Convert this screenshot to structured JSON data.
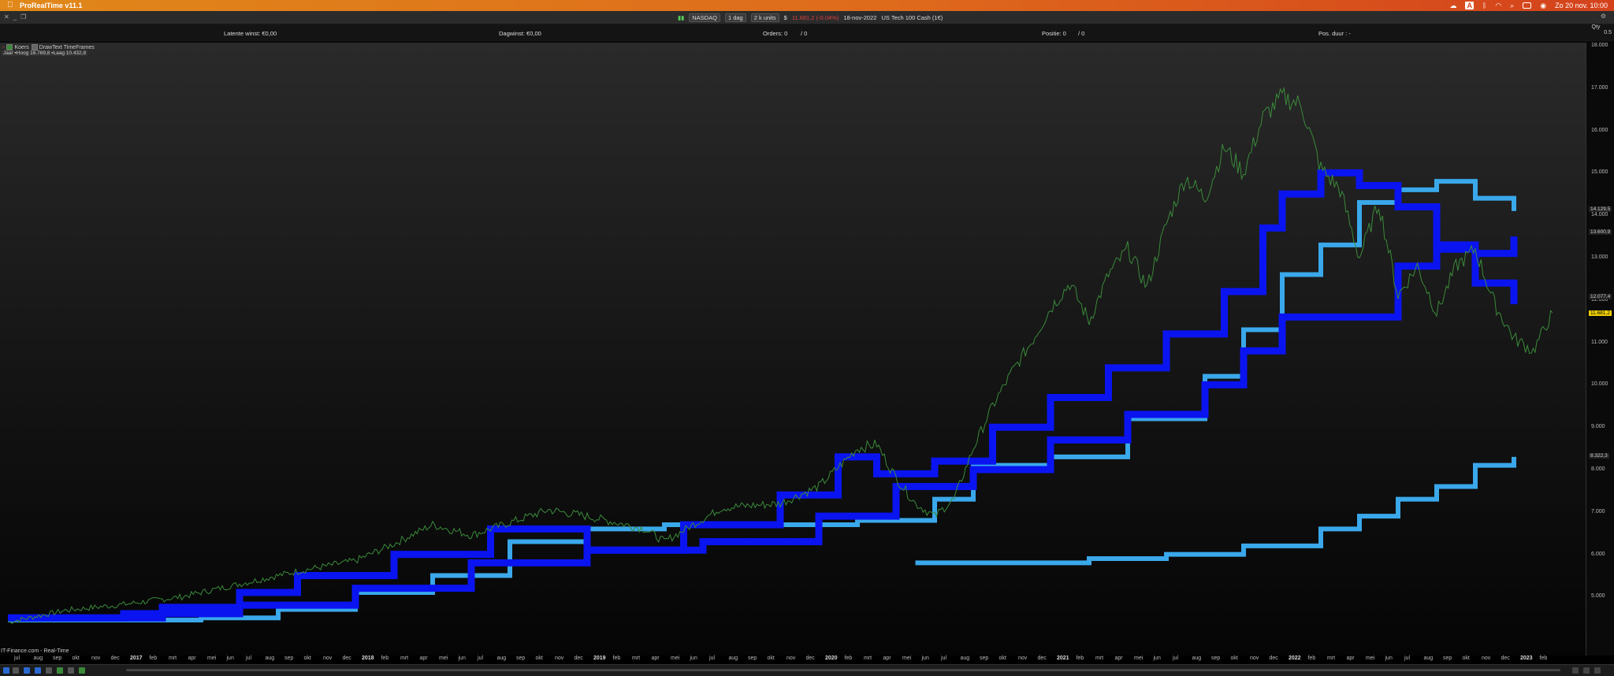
{
  "menubar": {
    "app_title": "ProRealTime v11.1",
    "datetime": "Zo 20 nov.  10:00",
    "status_letter": "A"
  },
  "toolbar": {
    "instrument": "NASDAQ",
    "timeframe": "1 dag",
    "units": "2 k units",
    "price_change": "11.681,2 (-0,04%)",
    "date": "18-nov-2022",
    "description": "US Tech 100 Cash (1€)"
  },
  "infobar": {
    "latent_gain": "Latente winst: €0,00",
    "day_gain": "Dagwinst: €0,00",
    "orders": "Orders: 0",
    "orders_suffix": "/ 0",
    "position": "Positie: 0",
    "position_suffix": "/ 0",
    "pos_duration": "Pos. duur : -",
    "qty_label": "Qty",
    "qty_value": "0.5"
  },
  "legend": {
    "item1": "Koers",
    "item2": "DrawText TimeFrames",
    "range": "Jaar ▪Hoog 16.769,8 ▪Laag 10.432,8"
  },
  "source": "IT-Finance.com - Real-Time",
  "colors": {
    "price_line": "#3a8a3a",
    "dark_blue": "#0a14f0",
    "light_blue": "#3aa8ea",
    "accent_yellow": "#f0d000"
  },
  "chart_data": {
    "type": "line",
    "y_ticks": [
      "18.000",
      "17.000",
      "16.000",
      "15.000",
      "14.000",
      "13.000",
      "12.000",
      "11.000",
      "10.000",
      "9.000",
      "8.000",
      "7.000",
      "6.000",
      "5.000"
    ],
    "price_labels": [
      "14.129,5",
      "13.600,9",
      "12.077,4",
      "11.681,2",
      "8.322,3"
    ],
    "highlighted_price": "11.681,2",
    "x_ticks": [
      "jul",
      "aug",
      "sep",
      "okt",
      "nov",
      "dec",
      "2017",
      "feb",
      "mrt",
      "apr",
      "mei",
      "jun",
      "jul",
      "aug",
      "sep",
      "okt",
      "nov",
      "dec",
      "2018",
      "feb",
      "mrt",
      "apr",
      "mei",
      "jun",
      "jul",
      "aug",
      "sep",
      "okt",
      "nov",
      "dec",
      "2019",
      "feb",
      "mrt",
      "apr",
      "mei",
      "jun",
      "jul",
      "aug",
      "sep",
      "okt",
      "nov",
      "dec",
      "2020",
      "feb",
      "mrt",
      "apr",
      "mei",
      "jun",
      "jul",
      "aug",
      "sep",
      "okt",
      "nov",
      "dec",
      "2021",
      "feb",
      "mrt",
      "apr",
      "mei",
      "jun",
      "jul",
      "aug",
      "sep",
      "okt",
      "nov",
      "dec",
      "2022",
      "feb",
      "mrt",
      "apr",
      "mei",
      "jun",
      "jul",
      "aug",
      "sep",
      "okt",
      "nov",
      "dec",
      "2023",
      "feb"
    ],
    "ylim": [
      4700,
      18000
    ],
    "price_series": [
      [
        0,
        4400
      ],
      [
        3,
        4680
      ],
      [
        6,
        4820
      ],
      [
        9,
        5000
      ],
      [
        12,
        5300
      ],
      [
        15,
        5600
      ],
      [
        18,
        5850
      ],
      [
        20,
        6250
      ],
      [
        22,
        6700
      ],
      [
        24,
        6450
      ],
      [
        26,
        6750
      ],
      [
        28,
        7050
      ],
      [
        30,
        6900
      ],
      [
        33,
        6600
      ],
      [
        34,
        6300
      ],
      [
        37,
        7100
      ],
      [
        40,
        7200
      ],
      [
        42,
        7600
      ],
      [
        44,
        8500
      ],
      [
        45,
        8600
      ],
      [
        46,
        7800
      ],
      [
        47,
        7200
      ],
      [
        48,
        6900
      ],
      [
        49,
        7300
      ],
      [
        50,
        8500
      ],
      [
        51,
        9500
      ],
      [
        52,
        10300
      ],
      [
        53,
        11000
      ],
      [
        54,
        11800
      ],
      [
        55,
        12400
      ],
      [
        56,
        11500
      ],
      [
        57,
        12600
      ],
      [
        58,
        13200
      ],
      [
        59,
        12300
      ],
      [
        60,
        13800
      ],
      [
        61,
        14900
      ],
      [
        62,
        14400
      ],
      [
        63,
        15600
      ],
      [
        64,
        15000
      ],
      [
        65,
        16300
      ],
      [
        66,
        16800
      ],
      [
        67,
        16600
      ],
      [
        68,
        15100
      ],
      [
        69,
        14600
      ],
      [
        70,
        13000
      ],
      [
        71,
        14300
      ],
      [
        72,
        12100
      ],
      [
        73,
        12800
      ],
      [
        74,
        11700
      ],
      [
        75,
        12800
      ],
      [
        76,
        13200
      ],
      [
        77,
        11900
      ],
      [
        78,
        11100
      ],
      [
        79,
        10800
      ],
      [
        80,
        11700
      ]
    ],
    "dark_blue_steps": [
      [
        [
          0,
          4500
        ],
        [
          6,
          4600
        ],
        [
          8,
          4750
        ],
        [
          12,
          5100
        ],
        [
          15,
          5500
        ],
        [
          20,
          6000
        ],
        [
          25,
          6600
        ],
        [
          30,
          6100
        ],
        [
          35,
          6700
        ],
        [
          40,
          7400
        ],
        [
          43,
          8300
        ],
        [
          45,
          7900
        ],
        [
          48,
          8200
        ],
        [
          51,
          9000
        ],
        [
          54,
          9700
        ],
        [
          57,
          10400
        ],
        [
          60,
          11200
        ],
        [
          63,
          12200
        ],
        [
          65,
          13700
        ],
        [
          66,
          14500
        ],
        [
          68,
          15000
        ],
        [
          70,
          14700
        ],
        [
          72,
          14200
        ],
        [
          74,
          13300
        ],
        [
          76,
          12400
        ],
        [
          78,
          11900
        ]
      ],
      [
        [
          0,
          4500
        ],
        [
          8,
          4600
        ],
        [
          12,
          4800
        ],
        [
          18,
          5200
        ],
        [
          24,
          5800
        ],
        [
          30,
          6100
        ],
        [
          36,
          6300
        ],
        [
          42,
          6900
        ],
        [
          46,
          7600
        ],
        [
          50,
          8000
        ],
        [
          54,
          8700
        ],
        [
          58,
          9300
        ],
        [
          62,
          10000
        ],
        [
          64,
          10800
        ],
        [
          66,
          11600
        ],
        [
          70,
          11600
        ],
        [
          72,
          12800
        ],
        [
          74,
          13200
        ],
        [
          76,
          13100
        ],
        [
          78,
          13500
        ]
      ]
    ],
    "light_blue_steps": [
      [
        [
          0,
          4450
        ],
        [
          10,
          4500
        ],
        [
          14,
          4700
        ],
        [
          18,
          5100
        ],
        [
          22,
          5500
        ],
        [
          26,
          6300
        ],
        [
          30,
          6600
        ],
        [
          34,
          6700
        ],
        [
          38,
          6700
        ],
        [
          44,
          6800
        ],
        [
          48,
          7300
        ],
        [
          50,
          8100
        ],
        [
          54,
          8300
        ],
        [
          58,
          9200
        ],
        [
          62,
          10200
        ],
        [
          64,
          11300
        ],
        [
          66,
          12600
        ],
        [
          68,
          13300
        ],
        [
          70,
          14300
        ],
        [
          72,
          14600
        ],
        [
          74,
          14800
        ],
        [
          76,
          14400
        ],
        [
          78,
          14100
        ]
      ],
      [
        [
          47,
          5800
        ],
        [
          52,
          5800
        ],
        [
          56,
          5900
        ],
        [
          60,
          6000
        ],
        [
          64,
          6200
        ],
        [
          68,
          6600
        ],
        [
          70,
          6900
        ],
        [
          72,
          7300
        ],
        [
          74,
          7600
        ],
        [
          76,
          8100
        ],
        [
          78,
          8300
        ]
      ]
    ]
  }
}
